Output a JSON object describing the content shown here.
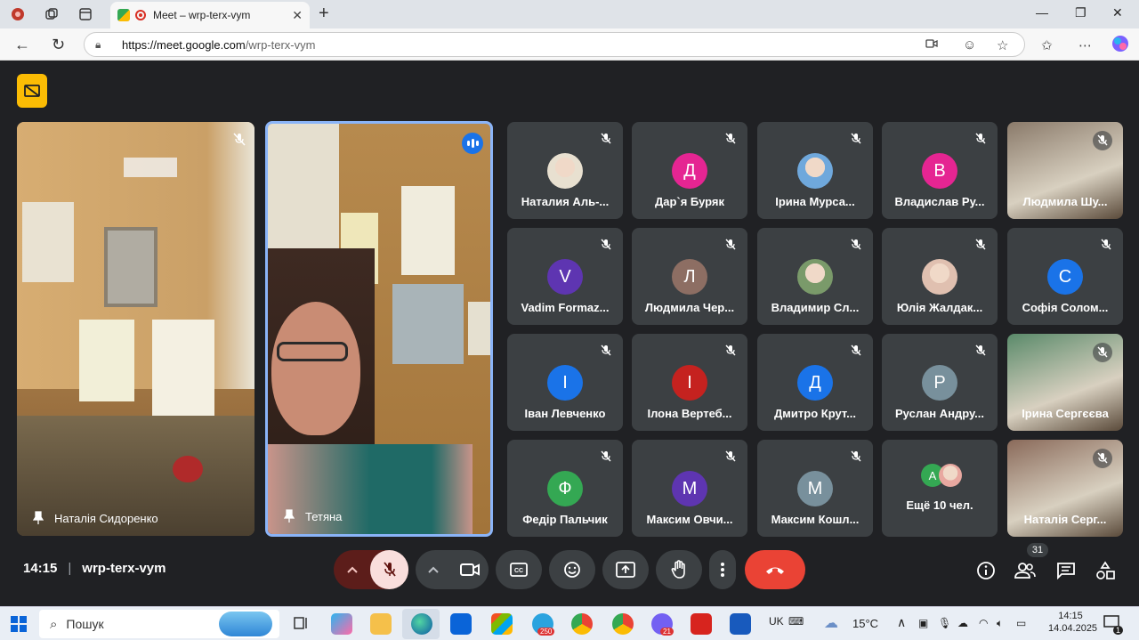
{
  "browser": {
    "tab_title": "Meet – wrp-terx-vym",
    "url_host": "https://meet.google.com",
    "url_path": "/wrp-terx-vym"
  },
  "meet": {
    "main_tiles": [
      {
        "name": "Наталія Сидоренко"
      },
      {
        "name": "Тетяна"
      }
    ],
    "participants": [
      {
        "name": "Наталия Аль-...",
        "initial": "",
        "color": "#e8e0d0",
        "photo": true
      },
      {
        "name": "Дар`я Буряк",
        "initial": "Д",
        "color": "#e52592",
        "photo": false
      },
      {
        "name": "Ірина Мурса...",
        "initial": "",
        "color": "#6fa8dc",
        "photo": true
      },
      {
        "name": "Владислав Ру...",
        "initial": "В",
        "color": "#e52592",
        "photo": false
      },
      {
        "name": "Людмила Шу...",
        "initial": "",
        "color": "#8a7a6a",
        "photo": true
      },
      {
        "name": "Vadim Formaz...",
        "initial": "V",
        "color": "#5e35b1",
        "photo": false
      },
      {
        "name": "Людмила Чер...",
        "initial": "Л",
        "color": "#8d6e63",
        "photo": false
      },
      {
        "name": "Владимир Сл...",
        "initial": "",
        "color": "#7a9a6a",
        "photo": true
      },
      {
        "name": "Юлія Жалдак...",
        "initial": "",
        "color": "#e0c0b0",
        "photo": true
      },
      {
        "name": "Софія Солом...",
        "initial": "С",
        "color": "#1a73e8",
        "photo": false
      },
      {
        "name": "Іван Левченко",
        "initial": "І",
        "color": "#1a73e8",
        "photo": false
      },
      {
        "name": "Ілона Вертеб...",
        "initial": "І",
        "color": "#c5221f",
        "photo": false
      },
      {
        "name": "Дмитро Крут...",
        "initial": "Д",
        "color": "#1a73e8",
        "photo": false
      },
      {
        "name": "Руслан Андру...",
        "initial": "Р",
        "color": "#78909c",
        "photo": false
      },
      {
        "name": "Ірина Сергєєва",
        "initial": "",
        "color": "#5a8a6a",
        "photo": true
      },
      {
        "name": "Федір Пальчик",
        "initial": "Ф",
        "color": "#34a853",
        "photo": false
      },
      {
        "name": "Максим Овчи...",
        "initial": "М",
        "color": "#5e35b1",
        "photo": false
      },
      {
        "name": "Максим Кошл...",
        "initial": "М",
        "color": "#78909c",
        "photo": false
      },
      {
        "name": "Ещё 10 чел.",
        "initial": "А",
        "color": "#34a853",
        "photo": false
      },
      {
        "name": "Наталія Серг...",
        "initial": "",
        "color": "#8a6a5a",
        "photo": true
      }
    ],
    "time": "14:15",
    "separator": "|",
    "meeting_code": "wrp-terx-vym",
    "participants_count": "31"
  },
  "taskbar": {
    "search_placeholder": "Пошук",
    "lang": "UK",
    "weather": "15°C",
    "clock_time": "14:15",
    "clock_date": "14.04.2025",
    "telegram_badge": "250",
    "viber_badge": "21",
    "notification_badge": "1"
  }
}
